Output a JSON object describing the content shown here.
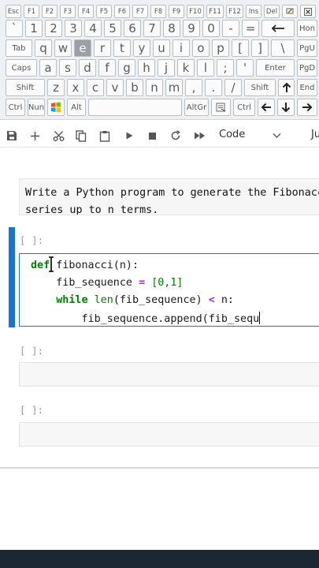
{
  "keyboard": {
    "row_fn": [
      "Esc",
      "F1",
      "F2",
      "F3",
      "F4",
      "F5",
      "F6",
      "F7",
      "F8",
      "F9",
      "F10",
      "F11",
      "F12",
      "Ins",
      "Del"
    ],
    "row_num": [
      "`",
      "1",
      "2",
      "3",
      "4",
      "5",
      "6",
      "7",
      "8",
      "9",
      "0",
      "-",
      "=",
      "Hon"
    ],
    "row_q": [
      "Tab",
      "q",
      "w",
      "e",
      "r",
      "t",
      "y",
      "u",
      "i",
      "o",
      "p",
      "[",
      "]",
      "\\",
      "PgU"
    ],
    "row_a": [
      "Caps",
      "a",
      "s",
      "d",
      "f",
      "g",
      "h",
      "j",
      "k",
      "l",
      ";",
      "'",
      "Enter",
      "PgD"
    ],
    "row_z": [
      "Shift",
      "z",
      "x",
      "c",
      "v",
      "b",
      "n",
      "m",
      ",",
      ".",
      "/",
      "Shift",
      "End"
    ],
    "row_ctrl": [
      "Ctrl",
      "Nun",
      "Alt",
      "AltGr",
      "Ctrl"
    ],
    "pressed_key": "e"
  },
  "toolbar": {
    "cell_type": "Code",
    "kernel_label_partial": "Ju"
  },
  "notebook": {
    "markdown_text": "Write a Python program to generate the Fibonacci\nseries up to n terms.",
    "active_prompt": "[ ]:",
    "code_lines": {
      "l1_kw": "def",
      "l1_rest": " fibonacci(n):",
      "l2_name": "    fib_sequence ",
      "l2_eq": "=",
      "l2_space": " ",
      "l2_list": "[0,1]",
      "l3_indent": "    ",
      "l3_kw": "while",
      "l3_sp": " ",
      "l3_len": "len",
      "l3_mid": "(fib_sequence) ",
      "l3_lt": "<",
      "l3_end": " n:",
      "l4_text": "        fib_sequence.append(fib_sequ"
    },
    "empty_prompt_1": "[ ]:",
    "empty_prompt_2": "[ ]:"
  },
  "colors": {
    "accent": "#1a73d1",
    "keyword": "#008000",
    "operator": "#aa22ff",
    "bottom_bar": "#1d2731"
  }
}
